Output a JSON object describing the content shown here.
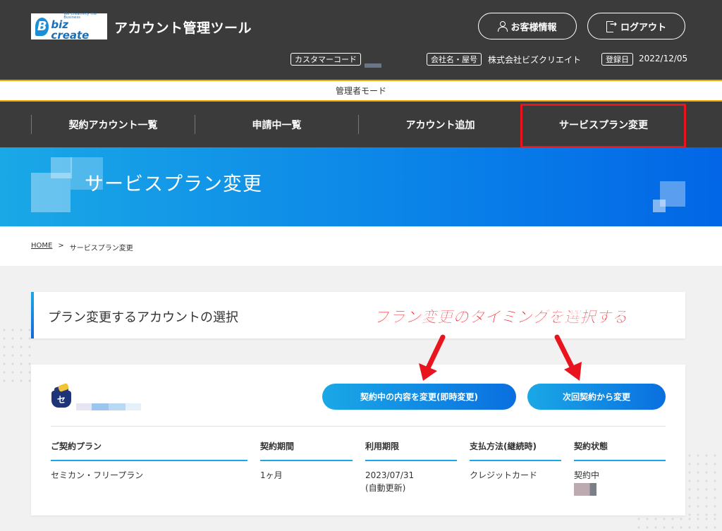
{
  "header": {
    "logo_name": "biz create",
    "logo_tagline": "We Creativity the Business",
    "app_title": "アカウント管理ツール",
    "customer_button": "お客様情報",
    "logout_button": "ログアウト",
    "customer_code_label": "カスタマーコード",
    "company_label": "会社名・屋号",
    "company_value": "株式会社ビズクリエイト",
    "registered_label": "登録日",
    "registered_value": "2022/12/05"
  },
  "mode_bar": {
    "label": "管理者モード"
  },
  "nav": {
    "items": [
      {
        "label": "契約アカウント一覧"
      },
      {
        "label": "申請中一覧"
      },
      {
        "label": "アカウント追加"
      },
      {
        "label": "サービスプラン変更"
      }
    ]
  },
  "hero": {
    "title": "サービスプラン変更"
  },
  "breadcrumb": {
    "home": "HOME",
    "separator": ">",
    "current": "サービスプラン変更"
  },
  "section": {
    "title": "プラン変更するアカウントの選択"
  },
  "annotation": {
    "text": "プラン変更のタイミングを選択する",
    "color": "#e8141e"
  },
  "account": {
    "icon_char": "セ",
    "btn_change_now": "契約中の内容を変更(即時変更)",
    "btn_change_next": "次回契約から変更",
    "columns": [
      "ご契約プラン",
      "契約期間",
      "利用期限",
      "支払方法(継続時)",
      "契約状態"
    ],
    "row": {
      "plan": "セミカン・フリープラン",
      "period": "1ヶ月",
      "expiry": "2023/07/31",
      "expiry_note": "(自動更新)",
      "payment": "クレジットカード",
      "status": "契約中"
    }
  },
  "colors": {
    "header_bg": "#3b3b3b",
    "accent_orange": "#f2a900",
    "highlight_red": "#e8141e",
    "hero_start": "#1aa8e6",
    "hero_end": "#0266e6"
  }
}
